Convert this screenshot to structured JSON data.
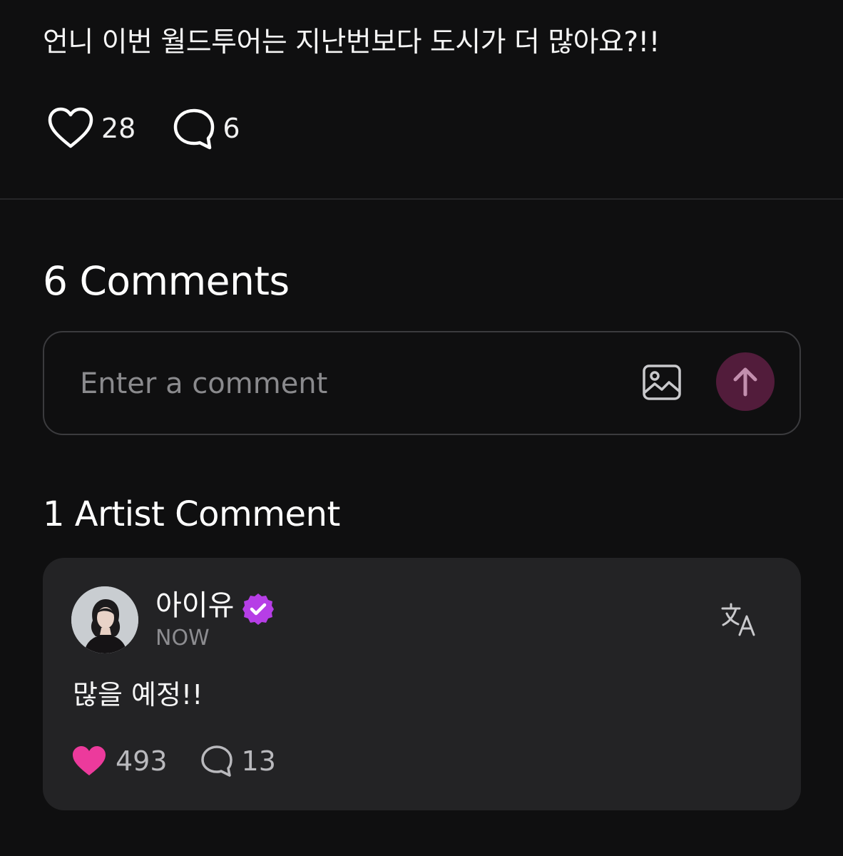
{
  "post": {
    "text": "언니 이번 월드투어는 지난번보다 도시가 더 많아요?!!",
    "likes": "28",
    "comments": "6"
  },
  "comments_section": {
    "title": "6 Comments",
    "input_placeholder": "Enter a comment"
  },
  "artist_section": {
    "title": "1 Artist Comment",
    "comment": {
      "author": "아이유",
      "timestamp": "NOW",
      "text": "많을 예정!!",
      "likes": "493",
      "replies": "13"
    }
  },
  "colors": {
    "background": "#0f0f10",
    "card": "#232325",
    "accent_pink": "#ec3a9c",
    "verified_purple": "#b63ee6",
    "send_button": "#521c3b"
  },
  "icons": [
    "heart-icon",
    "comment-bubble-icon",
    "image-icon",
    "arrow-up-icon",
    "verified-badge-icon",
    "translate-icon",
    "heart-filled-icon"
  ]
}
